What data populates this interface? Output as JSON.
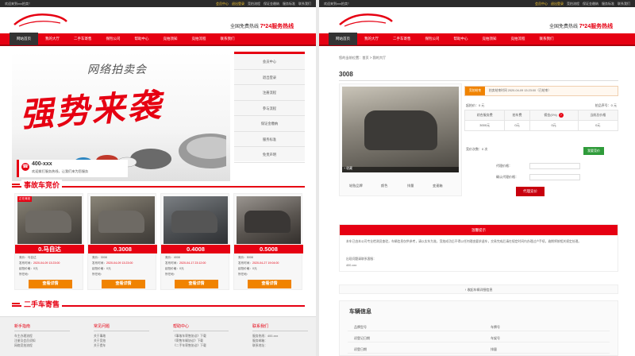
{
  "left": {
    "topbar": {
      "welcome": "欢迎来到xxx拍卖！",
      "links": [
        "会员中心",
        "退出登录",
        "竞拍流程",
        "保证金缴纳",
        "服务标准",
        "联系我们"
      ]
    },
    "header": {
      "hotline_prefix": "全国免费热线",
      "hotline": "7*24服务热线"
    },
    "nav": [
      "网站首页",
      "我的大厅",
      "二手车寄售",
      "保险公司",
      "帮助中心",
      "竞拍须知",
      "竞拍流程",
      "联系我们"
    ],
    "banner": {
      "title": "网络拍卖会",
      "slogan": "强势来袭",
      "phone": "400-xxx",
      "phone_desc": "欢迎拨打服务热线，让我们来为您服务"
    },
    "sidebar": [
      "会员中心",
      "退出登录",
      "注册流程",
      "参与流程",
      "保证金缴纳",
      "服务标准",
      "免责声明"
    ],
    "section1": "事故车竞价",
    "cards": [
      {
        "tag": "正在竞拍",
        "price": "0.马自达",
        "l1": "竞价：马自达",
        "l2": "发布时间：",
        "date": "2020-04-09 13:23:00",
        "l3": "起拍价格：0元",
        "l4": "所在地：",
        "btn": "查看详情"
      },
      {
        "tag": "",
        "price": "0.3008",
        "l1": "竞价：3008",
        "l2": "发布时间：",
        "date": "2020-04-09 13:23:00",
        "l3": "起拍价格：0元",
        "l4": "所在地：",
        "btn": "查看详情"
      },
      {
        "tag": "",
        "price": "0.4008",
        "l1": "竞价：4008",
        "l2": "发布时间：",
        "date": "2020-04-17 23:12:00",
        "l3": "起拍价格：0元",
        "l4": "所在地：",
        "btn": "查看详情"
      },
      {
        "tag": "",
        "price": "0.5008",
        "l1": "竞价：5008",
        "l2": "发布时间：",
        "date": "2020-04-27 19:04:00",
        "l3": "起拍价格：0元",
        "l4": "所在地：",
        "btn": "查看详情"
      }
    ],
    "section2": "二手车寄售",
    "footer": [
      {
        "title": "新手指南",
        "items": [
          "车主办理流程",
          "注册及会员须知",
          "网络竞拍流程"
        ]
      },
      {
        "title": "常见问题",
        "items": [
          "关于事故",
          "关于竞拍",
          "关于提车"
        ]
      },
      {
        "title": "帮助中心",
        "items": [
          "《事故车寄售协议》下载",
          "《寄售车辆协议》下载",
          "《二手车寄售协议》下载"
        ]
      },
      {
        "title": "联系我们",
        "items": [
          "服务热线：400-xxx",
          "服务邮箱：",
          "联系地址："
        ]
      }
    ]
  },
  "right": {
    "breadcrumb": "您的当前位置：首页 > 我的大厅",
    "title": "3008",
    "image_tag": "+ 收藏",
    "thumb_tabs": [
      "轮胎品牌",
      "颜色",
      "排量",
      "变速箱"
    ],
    "status_badge": "竞拍结束",
    "status_text": "拍卖结束时间 2020-04-09 13:23:00（已结束）",
    "price_line": "起拍价：0 元",
    "serial": "拍品序号：0 元",
    "table": {
      "headers": [
        "综合服务费",
        "拍车费",
        "佣金(0%)",
        "当前总价格"
      ],
      "values": [
        "3000元",
        "0元",
        "0元",
        "0元"
      ]
    },
    "bid_label": "竞价次数：0 次",
    "bid_btn": "我要竞价",
    "field1": "代理价格：",
    "field2": "确认代理价格：",
    "confirm_btn": "代理竞价",
    "notice": {
      "title": "温馨提示",
      "lines": [
        "本车已由本公司专业检测员查验，车辆信息仅供参考，请以实车为准，竞拍成功后不得以任何理由要求退车，交易完成后请在规定时间内办理过户手续，逾期将按相关规定处理。",
        "出现问题请联系客服：",
        "400-xxx"
      ]
    },
    "record_toggle": "收起车辆详细信息",
    "vehicle": {
      "title": "车辆信息",
      "rows": [
        [
          "品牌型号",
          "",
          "车牌号",
          ""
        ],
        [
          "初登记日期",
          "",
          "车架号",
          ""
        ],
        [
          "初登日期",
          "",
          "排量",
          ""
        ]
      ]
    }
  }
}
